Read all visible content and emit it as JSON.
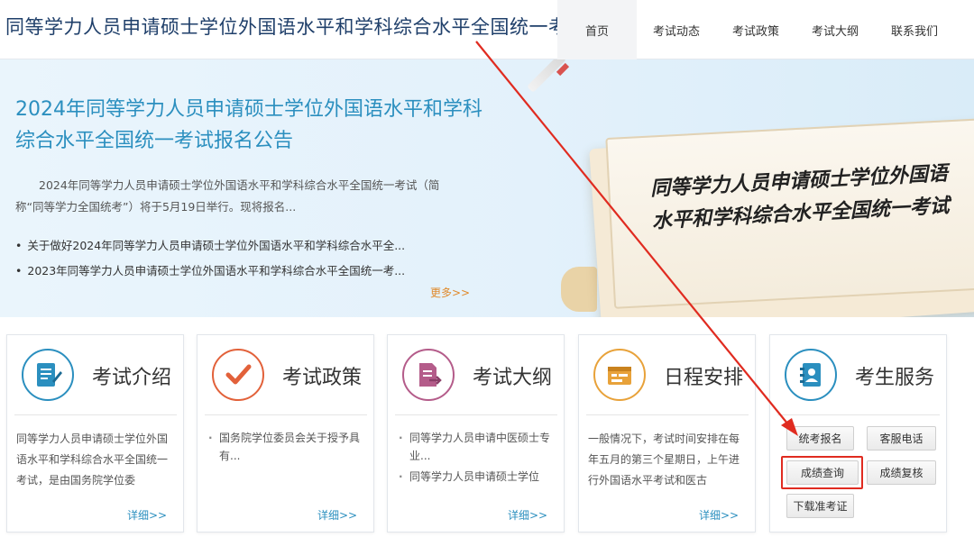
{
  "header": {
    "site_title": "同等学力人员申请硕士学位外国语水平和学科综合水平全国统一考试",
    "nav": [
      "首页",
      "考试动态",
      "考试政策",
      "考试大纲",
      "联系我们"
    ]
  },
  "banner": {
    "title": "2024年同等学力人员申请硕士学位外国语水平和学科综合水平全国统一考试报名公告",
    "desc": "2024年同等学力人员申请硕士学位外国语水平和学科综合水平全国统一考试（简称“同等学力全国统考”）将于5月19日举行。现将报名...",
    "news": [
      "关于做好2024年同等学力人员申请硕士学位外国语水平和学科综合水平全...",
      "2023年同等学力人员申请硕士学位外国语水平和学科综合水平全国统一考..."
    ],
    "more": "更多>>",
    "paper_text": "同等学力人员申请硕士学位外国语水平和学科综合水平全国统一考试"
  },
  "cards": [
    {
      "title": "考试介绍",
      "text": "同等学力人员申请硕士学位外国语水平和学科综合水平全国统一考试，是由国务院学位委",
      "more": "详细>>"
    },
    {
      "title": "考试政策",
      "items": [
        "国务院学位委员会关于授予具有..."
      ],
      "more": "详细>>"
    },
    {
      "title": "考试大纲",
      "items": [
        "同等学力人员申请中医硕士专业...",
        "同等学力人员申请硕士学位"
      ],
      "more": "详细>>"
    },
    {
      "title": "日程安排",
      "text": "一般情况下，考试时间安排在每年五月的第三个星期日，上午进行外国语水平考试和医古",
      "more": "详细>>"
    },
    {
      "title": "考生服务"
    }
  ],
  "services": {
    "register": "统考报名",
    "hotline": "客服电话",
    "score_query": "成绩查询",
    "score_review": "成绩复核",
    "admit_card": "下载准考证"
  },
  "colors": {
    "brand_blue": "#2b8fbf",
    "title_navy": "#1f3f6a",
    "more_orange": "#e08a2b",
    "highlight_red": "#e02b20"
  }
}
